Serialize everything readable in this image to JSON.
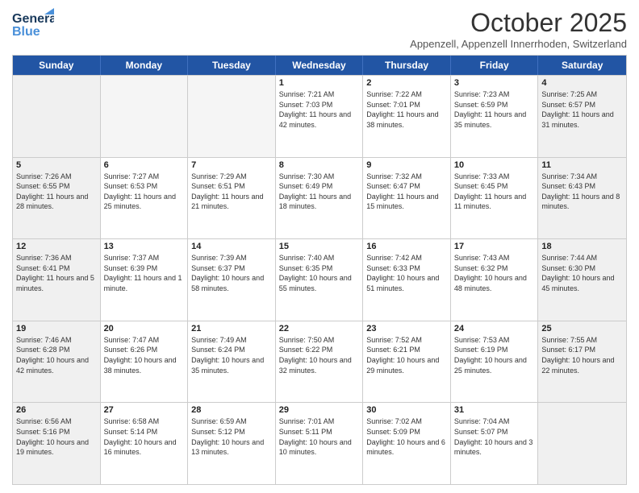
{
  "logo": {
    "line1": "General",
    "line2": "Blue"
  },
  "header": {
    "month": "October 2025",
    "location": "Appenzell, Appenzell Innerrhoden, Switzerland"
  },
  "days_of_week": [
    "Sunday",
    "Monday",
    "Tuesday",
    "Wednesday",
    "Thursday",
    "Friday",
    "Saturday"
  ],
  "weeks": [
    [
      {
        "day": "",
        "empty": true
      },
      {
        "day": "",
        "empty": true
      },
      {
        "day": "",
        "empty": true
      },
      {
        "day": "1",
        "sunrise": "7:21 AM",
        "sunset": "7:03 PM",
        "daylight": "11 hours and 42 minutes."
      },
      {
        "day": "2",
        "sunrise": "7:22 AM",
        "sunset": "7:01 PM",
        "daylight": "11 hours and 38 minutes."
      },
      {
        "day": "3",
        "sunrise": "7:23 AM",
        "sunset": "6:59 PM",
        "daylight": "11 hours and 35 minutes."
      },
      {
        "day": "4",
        "sunrise": "7:25 AM",
        "sunset": "6:57 PM",
        "daylight": "11 hours and 31 minutes."
      }
    ],
    [
      {
        "day": "5",
        "sunrise": "7:26 AM",
        "sunset": "6:55 PM",
        "daylight": "11 hours and 28 minutes."
      },
      {
        "day": "6",
        "sunrise": "7:27 AM",
        "sunset": "6:53 PM",
        "daylight": "11 hours and 25 minutes."
      },
      {
        "day": "7",
        "sunrise": "7:29 AM",
        "sunset": "6:51 PM",
        "daylight": "11 hours and 21 minutes."
      },
      {
        "day": "8",
        "sunrise": "7:30 AM",
        "sunset": "6:49 PM",
        "daylight": "11 hours and 18 minutes."
      },
      {
        "day": "9",
        "sunrise": "7:32 AM",
        "sunset": "6:47 PM",
        "daylight": "11 hours and 15 minutes."
      },
      {
        "day": "10",
        "sunrise": "7:33 AM",
        "sunset": "6:45 PM",
        "daylight": "11 hours and 11 minutes."
      },
      {
        "day": "11",
        "sunrise": "7:34 AM",
        "sunset": "6:43 PM",
        "daylight": "11 hours and 8 minutes."
      }
    ],
    [
      {
        "day": "12",
        "sunrise": "7:36 AM",
        "sunset": "6:41 PM",
        "daylight": "11 hours and 5 minutes."
      },
      {
        "day": "13",
        "sunrise": "7:37 AM",
        "sunset": "6:39 PM",
        "daylight": "11 hours and 1 minute."
      },
      {
        "day": "14",
        "sunrise": "7:39 AM",
        "sunset": "6:37 PM",
        "daylight": "10 hours and 58 minutes."
      },
      {
        "day": "15",
        "sunrise": "7:40 AM",
        "sunset": "6:35 PM",
        "daylight": "10 hours and 55 minutes."
      },
      {
        "day": "16",
        "sunrise": "7:42 AM",
        "sunset": "6:33 PM",
        "daylight": "10 hours and 51 minutes."
      },
      {
        "day": "17",
        "sunrise": "7:43 AM",
        "sunset": "6:32 PM",
        "daylight": "10 hours and 48 minutes."
      },
      {
        "day": "18",
        "sunrise": "7:44 AM",
        "sunset": "6:30 PM",
        "daylight": "10 hours and 45 minutes."
      }
    ],
    [
      {
        "day": "19",
        "sunrise": "7:46 AM",
        "sunset": "6:28 PM",
        "daylight": "10 hours and 42 minutes."
      },
      {
        "day": "20",
        "sunrise": "7:47 AM",
        "sunset": "6:26 PM",
        "daylight": "10 hours and 38 minutes."
      },
      {
        "day": "21",
        "sunrise": "7:49 AM",
        "sunset": "6:24 PM",
        "daylight": "10 hours and 35 minutes."
      },
      {
        "day": "22",
        "sunrise": "7:50 AM",
        "sunset": "6:22 PM",
        "daylight": "10 hours and 32 minutes."
      },
      {
        "day": "23",
        "sunrise": "7:52 AM",
        "sunset": "6:21 PM",
        "daylight": "10 hours and 29 minutes."
      },
      {
        "day": "24",
        "sunrise": "7:53 AM",
        "sunset": "6:19 PM",
        "daylight": "10 hours and 25 minutes."
      },
      {
        "day": "25",
        "sunrise": "7:55 AM",
        "sunset": "6:17 PM",
        "daylight": "10 hours and 22 minutes."
      }
    ],
    [
      {
        "day": "26",
        "sunrise": "6:56 AM",
        "sunset": "5:16 PM",
        "daylight": "10 hours and 19 minutes."
      },
      {
        "day": "27",
        "sunrise": "6:58 AM",
        "sunset": "5:14 PM",
        "daylight": "10 hours and 16 minutes."
      },
      {
        "day": "28",
        "sunrise": "6:59 AM",
        "sunset": "5:12 PM",
        "daylight": "10 hours and 13 minutes."
      },
      {
        "day": "29",
        "sunrise": "7:01 AM",
        "sunset": "5:11 PM",
        "daylight": "10 hours and 10 minutes."
      },
      {
        "day": "30",
        "sunrise": "7:02 AM",
        "sunset": "5:09 PM",
        "daylight": "10 hours and 6 minutes."
      },
      {
        "day": "31",
        "sunrise": "7:04 AM",
        "sunset": "5:07 PM",
        "daylight": "10 hours and 3 minutes."
      },
      {
        "day": "",
        "empty": true
      }
    ]
  ]
}
